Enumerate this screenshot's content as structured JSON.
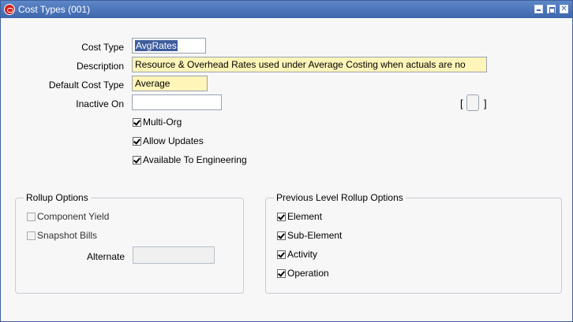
{
  "window": {
    "title": "Cost Types (001)"
  },
  "form": {
    "cost_type": {
      "label": "Cost Type",
      "value_selected": "AvgRates"
    },
    "description": {
      "label": "Description",
      "value": "Resource & Overhead Rates used under Average Costing when actuals are no"
    },
    "default_cost_type": {
      "label": "Default Cost Type",
      "value": "Average"
    },
    "inactive_on": {
      "label": "Inactive On",
      "value": ""
    },
    "dff": {
      "open": "[",
      "close": "]"
    }
  },
  "checks": {
    "multi_org": "Multi-Org",
    "allow_updates": "Allow Updates",
    "available_eng": "Available To Engineering"
  },
  "rollup_options": {
    "title": "Rollup Options",
    "component_yield": "Component Yield",
    "snapshot_bills": "Snapshot Bills",
    "alternate_label": "Alternate",
    "alternate_value": ""
  },
  "prev_level": {
    "title": "Previous Level Rollup Options",
    "element": "Element",
    "sub_element": "Sub-Element",
    "activity": "Activity",
    "operation": "Operation"
  },
  "colors": {
    "title_bar": "#3d66ad",
    "required_field": "#fff5b8",
    "selection": "#3d5c9c"
  }
}
